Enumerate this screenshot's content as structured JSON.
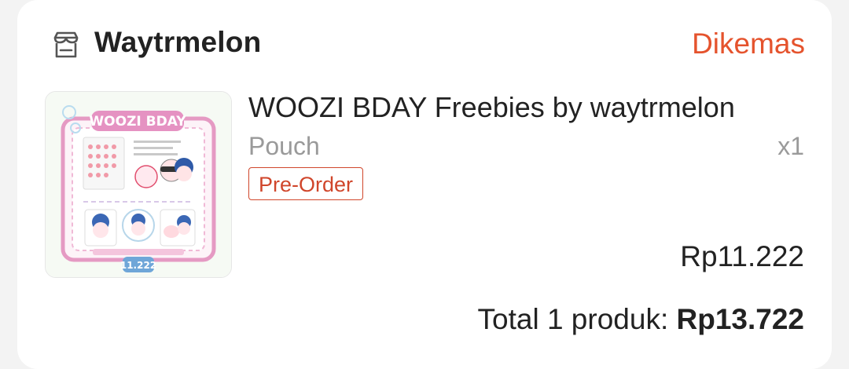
{
  "shop": {
    "name": "Waytrmelon",
    "icon": "shop-icon",
    "status": "Dikemas"
  },
  "product": {
    "title": "WOOZI BDAY Freebies by waytrmelon",
    "variant": "Pouch",
    "quantity": "x1",
    "badge": "Pre-Order",
    "price": "Rp11.222",
    "image": {
      "banner_text": "WOOZI BDAY",
      "number_text": "11.222"
    }
  },
  "summary": {
    "label": "Total 1 produk: ",
    "amount": "Rp13.722"
  },
  "colors": {
    "accent": "#e5532d",
    "badge": "#d0462b",
    "text": "#222222",
    "muted": "#9a9a9a"
  }
}
